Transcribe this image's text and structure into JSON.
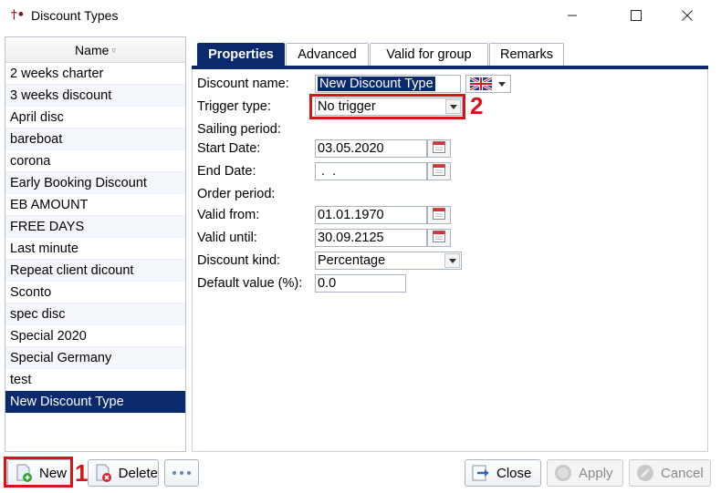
{
  "window": {
    "title": "Discount Types",
    "app_icon_glyph": "†•",
    "controls": [
      "minimize-icon",
      "maximize-icon",
      "close-icon"
    ]
  },
  "list": {
    "header": "Name",
    "sort_icon": "sort-filter-icon",
    "items": [
      "2 weeks charter",
      "3 weeks discount",
      "April disc",
      "bareboat",
      "corona",
      "Early Booking Discount",
      "EB AMOUNT",
      "FREE DAYS",
      "Last minute",
      "Repeat client dicount",
      "Sconto",
      "spec disc",
      "Special 2020",
      "Special Germany",
      "test",
      "New Discount Type"
    ],
    "selected_index": 15
  },
  "tabs": [
    {
      "label": "Properties",
      "active": true
    },
    {
      "label": "Advanced",
      "active": false
    },
    {
      "label": "Valid for group",
      "active": false
    },
    {
      "label": "Remarks",
      "active": false
    }
  ],
  "form": {
    "discount_name_label": "Discount name:",
    "discount_name_value": "New Discount Type",
    "language_flag": "uk-flag-icon",
    "trigger_type_label": "Trigger type:",
    "trigger_type_value": "No trigger",
    "sailing_period_label": "Sailing period:",
    "start_date_label": "Start Date:",
    "start_date_value": "03.05.2020",
    "end_date_label": "End Date:",
    "end_date_value": " .  .",
    "order_period_label": "Order period:",
    "valid_from_label": "Valid from:",
    "valid_from_value": "01.01.1970",
    "valid_until_label": "Valid until:",
    "valid_until_value": "30.09.2125",
    "discount_kind_label": "Discount kind:",
    "discount_kind_value": "Percentage",
    "default_value_label": "Default value (%):",
    "default_value_value": "0.0"
  },
  "buttons": {
    "new": "New",
    "delete": "Delete",
    "more": "more-options-icon",
    "close": "Close",
    "apply": "Apply",
    "cancel": "Cancel"
  },
  "annotations": {
    "step1": "1",
    "step2": "2",
    "highlight_color": "#d8141b"
  },
  "colors": {
    "accent": "#0b2a6e",
    "selection_text": "#ffffff"
  }
}
